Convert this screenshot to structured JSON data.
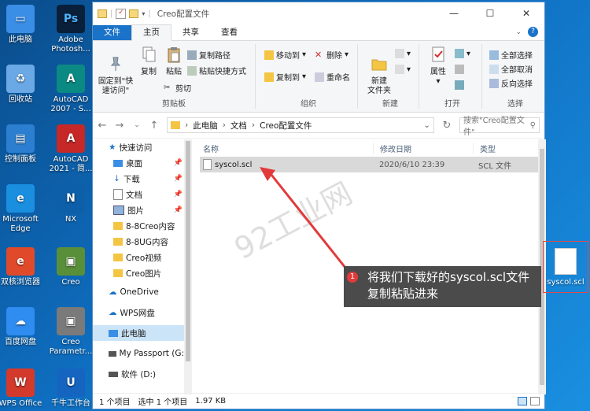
{
  "desktop": {
    "icons": [
      {
        "label": "此电脑",
        "icon": "computer-icon",
        "color": "#3a8ee6"
      },
      {
        "label": "回收站",
        "icon": "recycle-bin-icon",
        "color": "#6aa8e6"
      },
      {
        "label": "控制面板",
        "icon": "control-panel-icon",
        "color": "#2c7fd0"
      },
      {
        "label": "Microsoft\nEdge",
        "icon": "edge-icon",
        "color": "#1a8fe0"
      },
      {
        "label": "双核浏览器",
        "icon": "browser-icon",
        "color": "#e04a2a"
      },
      {
        "label": "百度网盘",
        "icon": "baidu-netdisk-icon",
        "color": "#2f8cf0"
      },
      {
        "label": "WPS Office",
        "icon": "wps-icon",
        "color": "#d33a2c"
      },
      {
        "label": "Adobe\nPhotosh...",
        "icon": "photoshop-icon",
        "color": "#0a1f3a"
      },
      {
        "label": "AutoCAD\n2007 - S...",
        "icon": "autocad2007-icon",
        "color": "#0b8a83"
      },
      {
        "label": "AutoCAD\n2021 - 简...",
        "icon": "autocad2021-icon",
        "color": "#c62828"
      },
      {
        "label": "NX",
        "icon": "nx-icon",
        "color": "#0c5fa8"
      },
      {
        "label": "Creo",
        "icon": "creo-icon",
        "color": "#5a8f3a"
      },
      {
        "label": "Creo\nParametr...",
        "icon": "creo-parametric-icon",
        "color": "#7a7a7a"
      },
      {
        "label": "千牛工作台",
        "icon": "qianniu-icon",
        "color": "#1565c0"
      }
    ],
    "file": {
      "label": "syscol.scl",
      "icon": "document-icon"
    }
  },
  "window": {
    "title": "Creo配置文件",
    "controls": {
      "minimize": "—",
      "maximize": "☐",
      "close": "✕"
    },
    "tabs": [
      "文件",
      "主页",
      "共享",
      "查看"
    ],
    "ribbon": {
      "clipboard": {
        "pin": "固定到\"快\n速访问\"",
        "copy": "复制",
        "paste": "粘贴",
        "cut": "剪切",
        "copy_path": "复制路径",
        "paste_shortcut": "粘贴快捷方式",
        "group": "剪贴板"
      },
      "organize": {
        "move_to": "移动到",
        "copy_to": "复制到",
        "delete": "删除",
        "rename": "重命名",
        "group": "组织"
      },
      "new": {
        "new_folder": "新建\n文件夹",
        "group": "新建"
      },
      "open": {
        "properties": "属性",
        "group": "打开"
      },
      "select": {
        "select_all": "全部选择",
        "select_none": "全部取消",
        "invert": "反向选择",
        "group": "选择"
      }
    },
    "address": {
      "parts": [
        "此电脑",
        "文档",
        "Creo配置文件"
      ],
      "search_placeholder": "搜索\"Creo配置文件\""
    },
    "sidebar": [
      {
        "label": "快速访问",
        "icon": "star-icon",
        "pinned": false
      },
      {
        "label": "桌面",
        "icon": "desktop-icon",
        "pinned": true
      },
      {
        "label": "下载",
        "icon": "download-icon",
        "pinned": true
      },
      {
        "label": "文档",
        "icon": "documents-icon",
        "pinned": true
      },
      {
        "label": "图片",
        "icon": "pictures-icon",
        "pinned": true
      },
      {
        "label": "8-8Creo内容",
        "icon": "folder-icon",
        "pinned": false
      },
      {
        "label": "8-8UG内容",
        "icon": "folder-icon",
        "pinned": false
      },
      {
        "label": "Creo视频",
        "icon": "folder-icon",
        "pinned": false
      },
      {
        "label": "Creo图片",
        "icon": "folder-icon",
        "pinned": false
      },
      {
        "label": "OneDrive",
        "icon": "onedrive-icon",
        "pinned": false
      },
      {
        "label": "WPS网盘",
        "icon": "wps-cloud-icon",
        "pinned": false
      },
      {
        "label": "此电脑",
        "icon": "this-pc-icon",
        "pinned": false
      },
      {
        "label": "My Passport (G:",
        "icon": "drive-icon",
        "pinned": false
      },
      {
        "label": "软件 (D:)",
        "icon": "drive-icon",
        "pinned": false
      }
    ],
    "columns": [
      "名称",
      "修改日期",
      "类型"
    ],
    "files": [
      {
        "name": "syscol.scl",
        "date": "2020/6/10 23:39",
        "type": "SCL 文件"
      }
    ],
    "status": {
      "count": "1 个项目",
      "selected": "选中 1 个项目",
      "size": "1.97 KB"
    }
  },
  "annotation": {
    "number": "1",
    "text": "将我们下载好的syscol.scl文件复制粘贴进来",
    "watermark": "92工业网"
  }
}
